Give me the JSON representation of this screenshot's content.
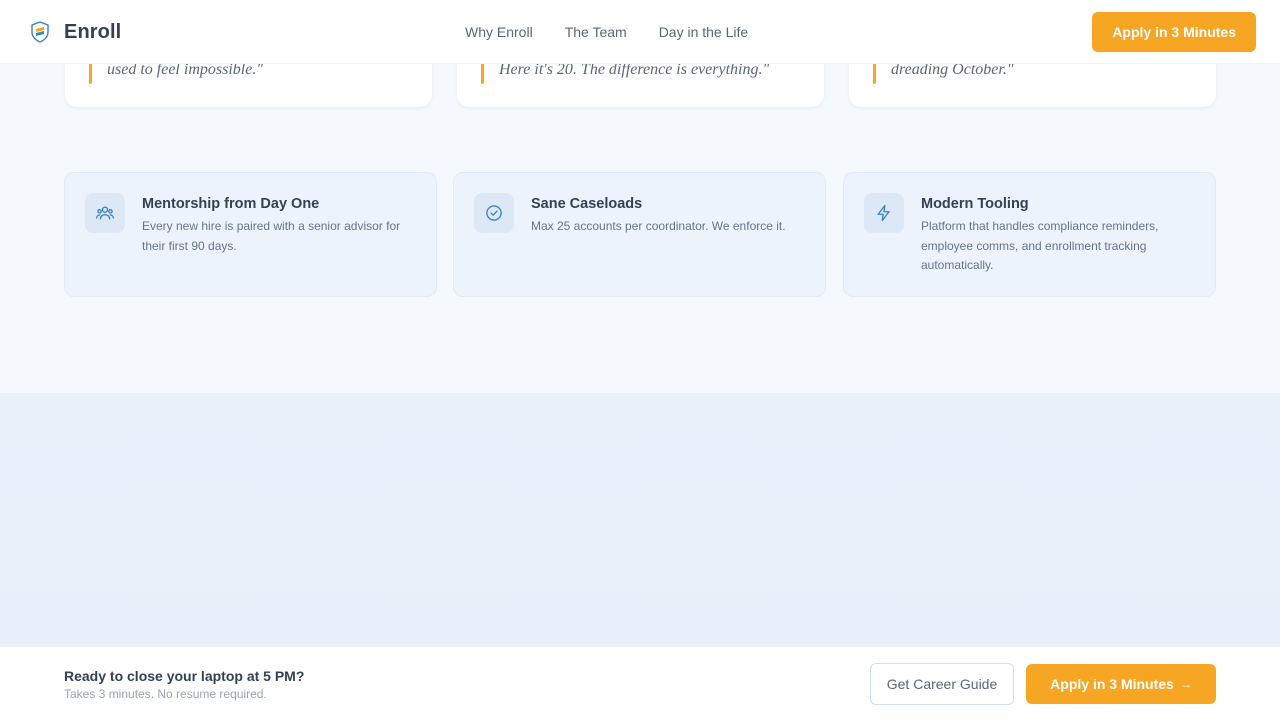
{
  "header": {
    "brand": "Enroll",
    "nav": [
      "Why Enroll",
      "The Team",
      "Day in the Life"
    ],
    "cta": "Apply in 3 Minutes"
  },
  "testimonials": [
    {
      "quote": "used to feel impossible.\""
    },
    {
      "quote": "Here it's 20. The difference is everything.\""
    },
    {
      "quote": "dreading October.\""
    }
  ],
  "features": [
    {
      "icon": "users-icon",
      "title": "Mentorship from Day One",
      "description": "Every new hire is paired with a senior advisor for their first 90 days."
    },
    {
      "icon": "check-circle-icon",
      "title": "Sane Caseloads",
      "description": "Max 25 accounts per coordinator. We enforce it."
    },
    {
      "icon": "lightning-icon",
      "title": "Modern Tooling",
      "description": "Platform that handles compliance reminders, employee comms, and enrollment tracking automatically."
    }
  ],
  "footer_bar": {
    "headline": "Ready to close your laptop at 5 PM?",
    "subtext": "Takes 3 minutes. No resume required.",
    "secondary_button": "Get Career Guide",
    "primary_button": "Apply in 3 Minutes",
    "primary_arrow": "→"
  },
  "colors": {
    "accent": "#f6a623",
    "icon_blue": "#3b82c4",
    "text_dark": "#334155",
    "text_muted": "#64748b"
  }
}
